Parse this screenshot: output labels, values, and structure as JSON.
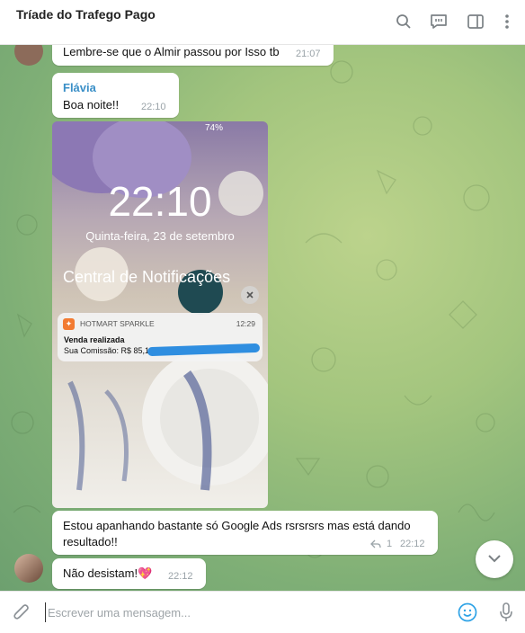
{
  "header": {
    "title": "Tríade do Trafego Pago"
  },
  "messages": {
    "m1": {
      "text": "Lembre-se que o Almir passou por Isso tb",
      "time": "21:07"
    },
    "m2": {
      "sender": "Flávia",
      "text": "Boa noite!!",
      "time": "22:10"
    },
    "m3": {
      "text": "Estou apanhando bastante só Google Ads rsrsrsrs mas está dando resultado!!",
      "time": "22:12",
      "reply_count": "1"
    },
    "m4": {
      "text": "Não desistam!💖",
      "time": "22:12"
    }
  },
  "photo": {
    "clock": "22:10",
    "date": "Quinta-feira, 23 de setembro",
    "battery": "74%",
    "notification_center": "Central de Notificações",
    "notif_app": "HOTMART SPARKLE",
    "notif_time": "12:29",
    "notif_title": "Venda realizada",
    "notif_body": "Sua Comissão: R$ 85,12"
  },
  "composer": {
    "placeholder": "Escrever uma mensagem..."
  },
  "icons": [
    "search-icon",
    "comments-icon",
    "sidebar-icon",
    "more-icon",
    "chevron-down-icon",
    "attach-icon",
    "emoji-icon",
    "microphone-icon"
  ],
  "colors": {
    "link": "#3a8fc7",
    "chat_bg": "#a3c57e",
    "icon": "#7b8185",
    "accent": "#2fa3e6"
  }
}
